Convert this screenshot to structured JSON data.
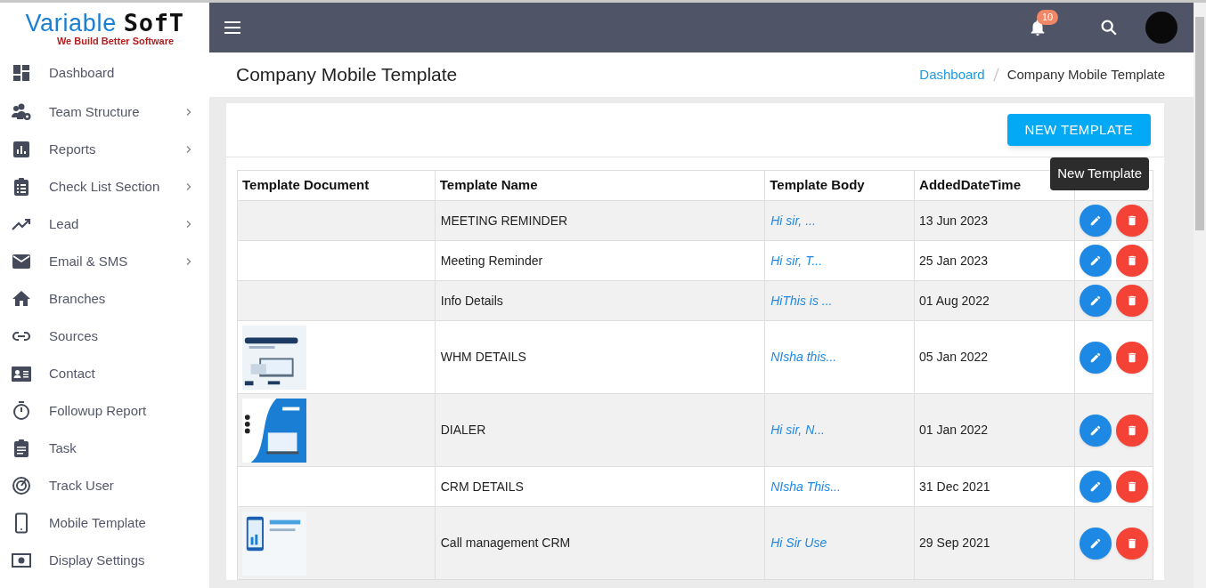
{
  "logo": {
    "name_part_1": "Variable",
    "name_part_2": "SofT",
    "tagline": "We Build Better Software"
  },
  "sidebar": {
    "items": [
      {
        "label": "Dashboard",
        "kind": "dashboard",
        "has_submenu": false
      },
      {
        "label": "Team Structure",
        "kind": "team",
        "has_submenu": true
      },
      {
        "label": "Reports",
        "kind": "reports",
        "has_submenu": true
      },
      {
        "label": "Check List Section",
        "kind": "checklist",
        "has_submenu": true
      },
      {
        "label": "Lead",
        "kind": "trend",
        "has_submenu": true
      },
      {
        "label": "Email & SMS",
        "kind": "mail",
        "has_submenu": true
      },
      {
        "label": "Branches",
        "kind": "home",
        "has_submenu": false
      },
      {
        "label": "Sources",
        "kind": "link",
        "has_submenu": false
      },
      {
        "label": "Contact",
        "kind": "contact",
        "has_submenu": false
      },
      {
        "label": "Followup Report",
        "kind": "timer",
        "has_submenu": false
      },
      {
        "label": "Task",
        "kind": "task",
        "has_submenu": false
      },
      {
        "label": "Track User",
        "kind": "track",
        "has_submenu": false
      },
      {
        "label": "Mobile Template",
        "kind": "mobile",
        "has_submenu": false
      },
      {
        "label": "Display Settings",
        "kind": "display",
        "has_submenu": false
      }
    ]
  },
  "header": {
    "notification_count": "10"
  },
  "page_title": "Company Mobile Template",
  "breadcrumb": [
    {
      "label": "Dashboard",
      "link": true
    },
    {
      "label": "Company Mobile Template",
      "link": false
    }
  ],
  "new_button": "NEW TEMPLATE",
  "tooltip": "New Template",
  "table": {
    "columns": [
      "Template Document",
      "Template Name",
      "Template Body",
      "AddedDateTime"
    ],
    "rows": [
      {
        "name": "MEETING REMINDER",
        "body": "Hi sir, ...",
        "date": "13 Jun 2023"
      },
      {
        "name": "Meeting Reminder",
        "body": "Hi sir, T...",
        "date": "25 Jan 2023"
      },
      {
        "name": "Info Details",
        "body": "HiThis is ...",
        "date": "01 Aug 2022"
      },
      {
        "name": "WHM DETAILS",
        "body": "NIsha this...",
        "date": "05 Jan 2022"
      },
      {
        "name": "DIALER",
        "body": "Hi sir, N...",
        "date": "01 Jan 2022"
      },
      {
        "name": "CRM DETAILS",
        "body": "NIsha This...",
        "date": "31 Dec 2021"
      },
      {
        "name": "Call management CRM",
        "body": "Hi Sir Use",
        "date": "29 Sep 2021"
      }
    ]
  }
}
